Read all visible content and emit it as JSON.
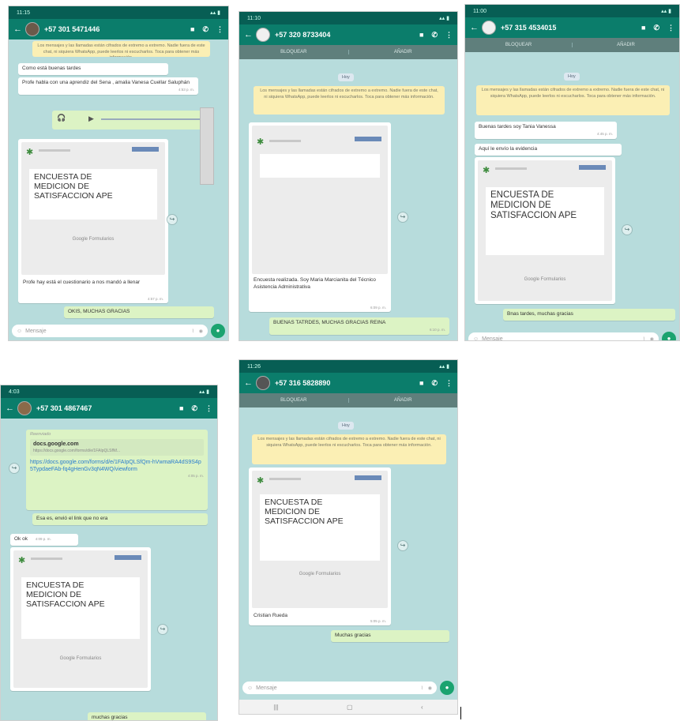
{
  "common": {
    "input_placeholder": "Mensaje",
    "forms_label": "Google Formularios",
    "survey_title": "ENCUESTA DE\nMEDICION DE\nSATISFACCION APE",
    "block_label": "BLOQUEAR",
    "add_label": "AÑADIR",
    "today_chip": "Hoy",
    "encryption_notice": "Los mensajes y las llamadas están cifrados de extremo a extremo. Nadie fuera de este chat, ni siquiera WhatsApp, puede leerlos ni escucharlos. Toca para obtener más información."
  },
  "phone1": {
    "status_time": "11:15",
    "contact": "+57 301 5471446",
    "messages": [
      {
        "text": "Como está buenas tardes",
        "time": "4:53 p. m."
      },
      {
        "text": "Profe habla con una aprendiz del Sena , amalia Vanesa Cuellar Saluphán",
        "time": "4:53 p. m."
      }
    ],
    "doc_caption": "Profe hay está el cuestionario a nos mandó a llenar",
    "doc_time": "4:57 p. m.",
    "reply": "OKIS, MUCHAS GRACIAS",
    "reply_time": "5:02 p. m."
  },
  "phone2": {
    "status_time": "11:10",
    "contact": "+57 320 8733404",
    "doc_caption": "Encuesta realizada. Soy Maria Marcianita del Técnico Asistencia Administrativa",
    "doc_time": "6:09 p. m.",
    "reply": "BUENAS TATRDES, MUCHAS GRACIAS REINA",
    "reply_time": "6:10 p. m."
  },
  "phone3": {
    "status_time": "11:00",
    "contact": "+57 315 4534015",
    "messages": [
      {
        "text": "Buenas tardes soy Tania Vanessa",
        "time": "4:45 p. m."
      },
      {
        "text": "Aquí le envío la evidencia",
        "time": "4:45 p. m."
      }
    ],
    "doc_time": "4:46 p. m.",
    "reply": "Bnas tardes, muchas gracias",
    "reply_time": "4:50 p. m."
  },
  "phone4": {
    "status_time": "4:03",
    "contact": "+57 301 4867467",
    "forwarded_label": "Reenviado",
    "link_domain": "docs.google.com",
    "link_preview": "https://docs.google.com/forms/d/e/1FAIpQLSfNf...",
    "link_url": "https://docs.google.com/forms/d/e/1FAIpQLSfQm-hVwmaRA4dS9S4p5TypdaeFAb-fq4gHenGv3qN4WQ/viewform",
    "link_time": "4:05 p. m.",
    "msg2": "Esa es, envió el link que no era",
    "msg2_time": "4:06 p. m.",
    "ok": "Ok ok",
    "ok_time": "4:09 p. m.",
    "last": "muchas gracias"
  },
  "phone5": {
    "status_time": "11:26",
    "contact": "+57 316 5828890",
    "doc_caption": "Cristian Rueda",
    "doc_time": "5:05 p. m.",
    "reply": "Muchas gracias",
    "reply_time": "5:21 p. m."
  }
}
